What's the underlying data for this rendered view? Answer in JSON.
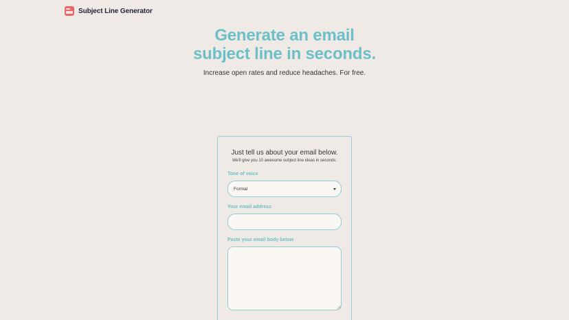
{
  "brand": {
    "name": "Subject Line Generator",
    "logo_icon": "email-logo-icon",
    "logo_color": "#e7676a"
  },
  "hero": {
    "title_line1": "Generate an email",
    "title_line2": "subject line in seconds.",
    "subtitle": "Increase open rates and reduce headaches. For free."
  },
  "form": {
    "title": "Just tell us about your email below.",
    "subtitle": "We'll give you 10 awesome subject line ideas in seconds.",
    "tone": {
      "label": "Tone of voice",
      "selected": "Formal"
    },
    "email": {
      "label": "Your email address",
      "value": ""
    },
    "body": {
      "label": "Paste your email body below",
      "value": ""
    }
  },
  "colors": {
    "accent": "#6dbfc7",
    "background": "#efeae5",
    "field_bg": "#faf7f4",
    "border": "#8fcfd5"
  }
}
